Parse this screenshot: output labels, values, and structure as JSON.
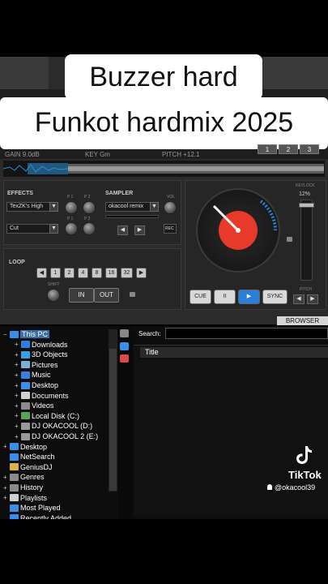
{
  "captions": {
    "line1": "Buzzer hard",
    "line2": "Funkot hardmix 2025"
  },
  "deck": {
    "gain": "GAIN 9.0dB",
    "key": "KEY Gm",
    "pitch": "PITCH +12.1",
    "hotcues": [
      "1",
      "2",
      "3"
    ],
    "effects_title": "EFFECTS",
    "effect_select": "TexZK's High",
    "effect2_select": "Cut",
    "p1": "P 1",
    "p2": "P 2",
    "sampler_title": "SAMPLER",
    "sampler_select": "okacool remix",
    "vol": "VOL",
    "rec": "REC",
    "loop_title": "LOOP",
    "loop_sizes": [
      "1",
      "2",
      "4",
      "8",
      "16",
      "32"
    ],
    "shift": "SHIFT",
    "in": "IN",
    "out": "OUT",
    "keylock": "KEYLOCK",
    "pitch_pct": "12%",
    "pitch_lbl": "PITCH",
    "transport": {
      "cue": "CUE",
      "pause": "II",
      "play": "▶",
      "sync": "SYNC"
    },
    "browser_tab": "BROWSER"
  },
  "browser": {
    "search_label": "Search:",
    "search_value": "",
    "column_title": "Title",
    "tree": [
      {
        "label": "This PC",
        "icon": "computer-icon",
        "color": "#3a8ee6",
        "indent": 0,
        "expander": "−",
        "selected": true
      },
      {
        "label": "Downloads",
        "icon": "download-arrow-icon",
        "color": "#2f7de0",
        "indent": 1,
        "expander": "+"
      },
      {
        "label": "3D Objects",
        "icon": "cube-icon",
        "color": "#3aa0e6",
        "indent": 1,
        "expander": "+"
      },
      {
        "label": "Pictures",
        "icon": "pictures-icon",
        "color": "#7ab0d8",
        "indent": 1,
        "expander": "+"
      },
      {
        "label": "Music",
        "icon": "music-note-icon",
        "color": "#3a7ee0",
        "indent": 1,
        "expander": "+"
      },
      {
        "label": "Desktop",
        "icon": "desktop-icon",
        "color": "#3a8ee6",
        "indent": 1,
        "expander": "+"
      },
      {
        "label": "Documents",
        "icon": "document-icon",
        "color": "#cfcfcf",
        "indent": 1,
        "expander": "+"
      },
      {
        "label": "Videos",
        "icon": "video-icon",
        "color": "#8a8a8a",
        "indent": 1,
        "expander": "+"
      },
      {
        "label": "Local Disk (C:)",
        "icon": "disk-icon",
        "color": "#5aa05a",
        "indent": 1,
        "expander": "+"
      },
      {
        "label": "DJ OKACOOL (D:)",
        "icon": "drive-icon",
        "color": "#999",
        "indent": 1,
        "expander": "+"
      },
      {
        "label": "DJ OKACOOL 2 (E:)",
        "icon": "drive-icon",
        "color": "#999",
        "indent": 1,
        "expander": "+"
      },
      {
        "label": "Desktop",
        "icon": "desktop-icon",
        "color": "#3a8ee6",
        "indent": 0,
        "expander": "+"
      },
      {
        "label": "NetSearch",
        "icon": "globe-icon",
        "color": "#3a8ee6",
        "indent": 0,
        "expander": ""
      },
      {
        "label": "GeniusDJ",
        "icon": "folder-icon",
        "color": "#d8b24a",
        "indent": 0,
        "expander": ""
      },
      {
        "label": "Genres",
        "icon": "genres-icon",
        "color": "#8a8a8a",
        "indent": 0,
        "expander": "+"
      },
      {
        "label": "History",
        "icon": "history-icon",
        "color": "#8a8a8a",
        "indent": 0,
        "expander": "+"
      },
      {
        "label": "Playlists",
        "icon": "playlist-icon",
        "color": "#cfcfcf",
        "indent": 0,
        "expander": "+"
      },
      {
        "label": "Most Played",
        "icon": "most-played-icon",
        "color": "#3a8ee6",
        "indent": 0,
        "expander": ""
      },
      {
        "label": "Recently Added",
        "icon": "recent-icon",
        "color": "#3a8ee6",
        "indent": 0,
        "expander": ""
      }
    ]
  },
  "watermark": {
    "brand": "TikTok",
    "user": "@okacool39"
  }
}
